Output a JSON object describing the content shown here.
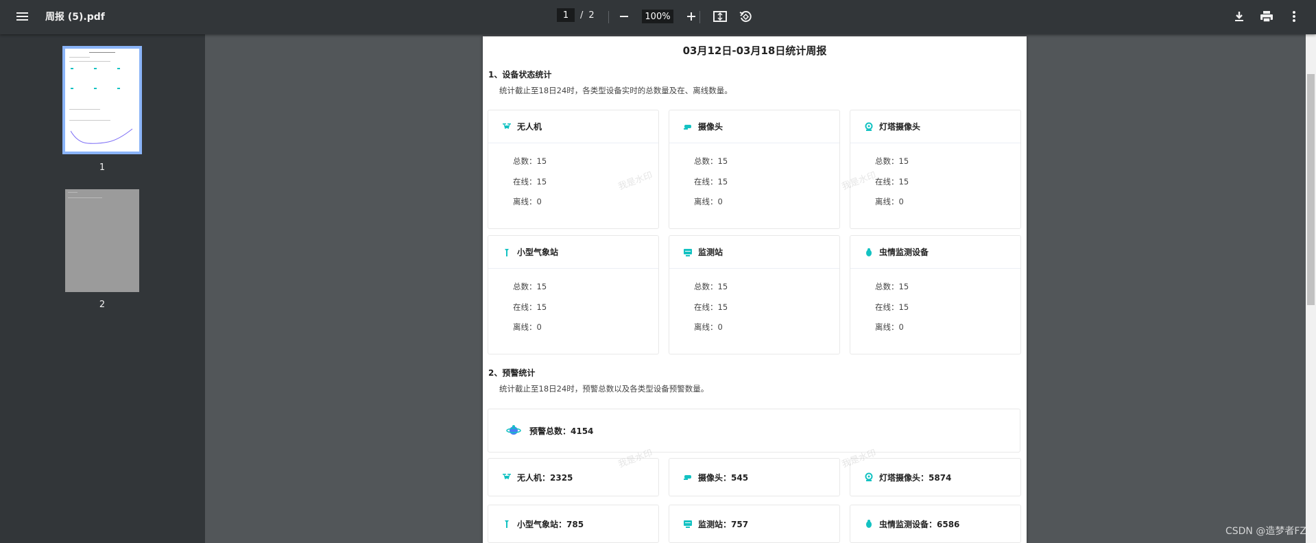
{
  "toolbar": {
    "file_name": "周报 (5).pdf",
    "current_page": "1",
    "page_separator": "/",
    "total_pages": "2",
    "zoom": "100%"
  },
  "sidebar": {
    "thumbnails": [
      {
        "label": "1"
      },
      {
        "label": "2"
      }
    ]
  },
  "report": {
    "title": "03月12日-03月18日统计周报",
    "section1": {
      "title": "1、设备状态统计",
      "desc": "统计截止至18日24时，各类型设备实时的总数量及在、离线数量。"
    },
    "device_cards": [
      {
        "name": "无人机",
        "icon": "drone-icon",
        "total": "总数：15",
        "online": "在线：15",
        "offline": "离线：0"
      },
      {
        "name": "摄像头",
        "icon": "camera-icon",
        "total": "总数：15",
        "online": "在线：15",
        "offline": "离线：0"
      },
      {
        "name": "灯塔摄像头",
        "icon": "lighthouse-camera-icon",
        "total": "总数：15",
        "online": "在线：15",
        "offline": "离线：0"
      },
      {
        "name": "小型气象站",
        "icon": "weather-station-icon",
        "total": "总数：15",
        "online": "在线：15",
        "offline": "离线：0"
      },
      {
        "name": "监测站",
        "icon": "monitor-station-icon",
        "total": "总数：15",
        "online": "在线：15",
        "offline": "离线：0"
      },
      {
        "name": "虫情监测设备",
        "icon": "pest-monitor-icon",
        "total": "总数：15",
        "online": "在线：15",
        "offline": "离线：0"
      }
    ],
    "section2": {
      "title": "2、预警统计",
      "desc": "统计截止至18日24时，预警总数以及各类型设备预警数量。"
    },
    "alarm_total": "预警总数：4154",
    "alarm_cards": [
      {
        "label": "无人机：2325",
        "icon": "drone-icon"
      },
      {
        "label": "摄像头：545",
        "icon": "camera-icon"
      },
      {
        "label": "灯塔摄像头：5874",
        "icon": "lighthouse-camera-icon"
      },
      {
        "label": "小型气象站：785",
        "icon": "weather-station-icon"
      },
      {
        "label": "监测站：757",
        "icon": "monitor-station-icon"
      },
      {
        "label": "虫情监测设备：6586",
        "icon": "pest-monitor-icon"
      }
    ],
    "watermark": "我是水印"
  },
  "footer_credit": "CSDN @造梦者FZ",
  "colors": {
    "toolbar_bg": "#323639",
    "viewer_bg": "#525659",
    "accent_icon": "#13c2c2",
    "thumb_highlight": "#8ab4f8"
  }
}
